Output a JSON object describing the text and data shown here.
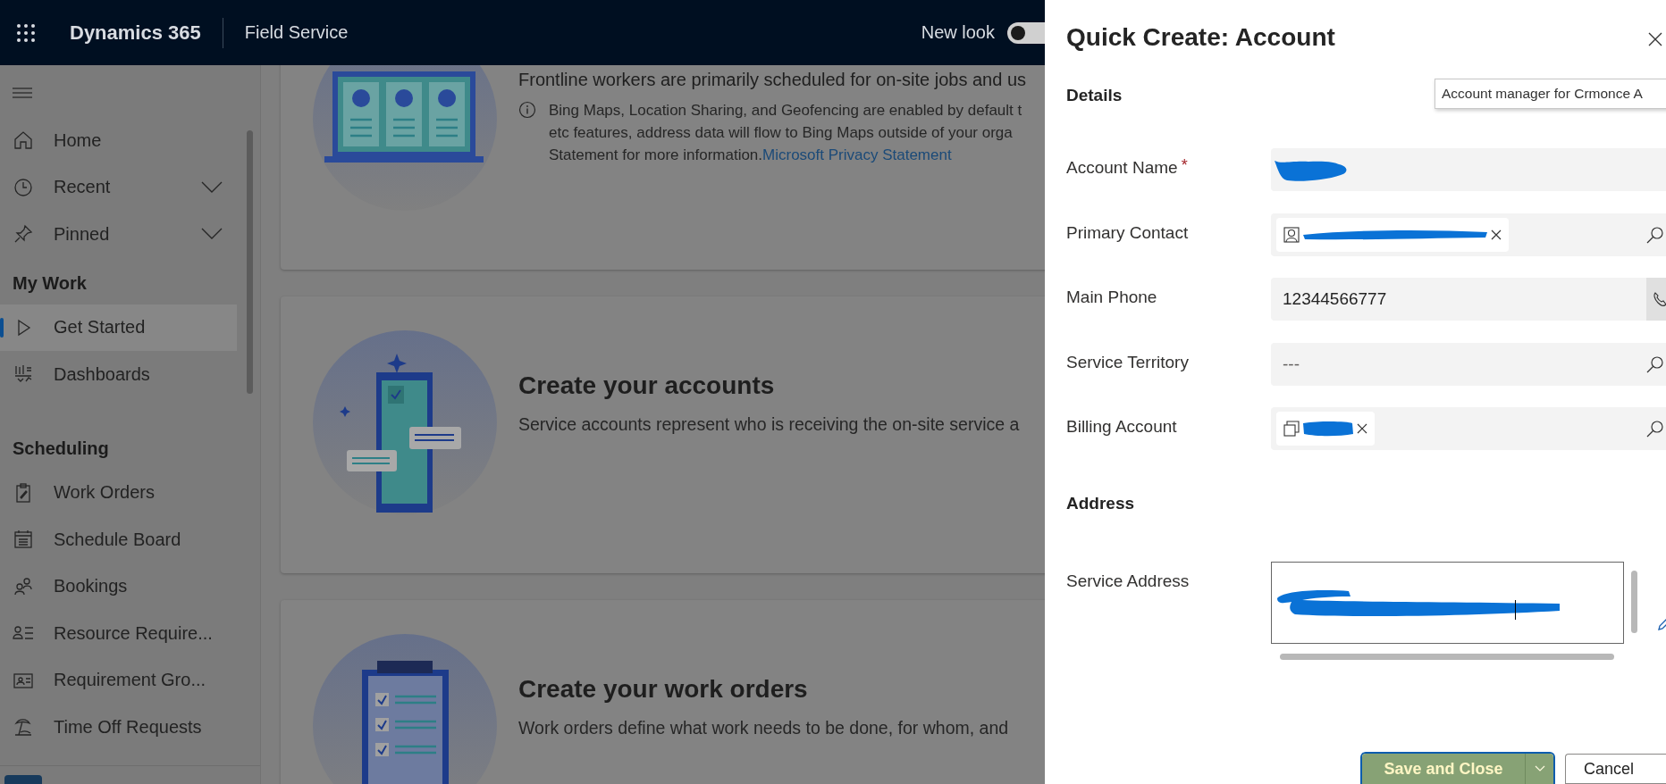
{
  "header": {
    "app_name": "Dynamics 365",
    "area": "Field Service",
    "new_look": {
      "label": "New look",
      "on": false
    }
  },
  "sidebar": {
    "groups": [
      {
        "items": [
          {
            "label": "Home",
            "selected": false
          },
          {
            "label": "Recent",
            "selected": false,
            "expanded": false
          },
          {
            "label": "Pinned",
            "selected": false,
            "expanded": false
          }
        ]
      },
      {
        "title": "My Work",
        "items": [
          {
            "label": "Get Started",
            "selected": true
          },
          {
            "label": "Dashboards",
            "selected": false
          }
        ]
      },
      {
        "title": "Scheduling",
        "items": [
          {
            "label": "Work Orders",
            "selected": false
          },
          {
            "label": "Schedule Board",
            "selected": false
          },
          {
            "label": "Bookings",
            "selected": false
          },
          {
            "label": "Resource Require...",
            "selected": false
          },
          {
            "label": "Requirement Gro...",
            "selected": false
          },
          {
            "label": "Time Off Requests",
            "selected": false
          }
        ]
      }
    ]
  },
  "cards": [
    {
      "kind": "laptop",
      "lead": "Frontline workers are primarily scheduled for on-site jobs and us",
      "note_lines": [
        "Bing Maps, Location Sharing, and Geofencing are enabled by default t",
        "etc features, address data will flow to Bing Maps outside of your orga",
        "Statement for more information."
      ],
      "link": "Microsoft Privacy Statement"
    },
    {
      "kind": "phone",
      "title": "Create your accounts",
      "text": "Service accounts represent who is receiving the on-site service a"
    },
    {
      "kind": "clipboard",
      "title": "Create your work orders",
      "text": "Work orders define what work needs to be done, for whom, and"
    }
  ],
  "quick_create": {
    "title": "Quick Create: Account",
    "tooltip": "Account manager for Crmonce A",
    "sections": [
      {
        "title": "Details",
        "fields": [
          {
            "label": "Account Name",
            "required_mark": "*",
            "kind": "text",
            "redacted": true
          },
          {
            "label": "Primary Contact",
            "kind": "lookup",
            "chip": {
              "kind": "contact",
              "redacted": true
            }
          },
          {
            "label": "Main Phone",
            "kind": "phone",
            "value": "12344566777"
          },
          {
            "label": "Service Territory",
            "kind": "lookup",
            "placeholder": "---"
          },
          {
            "label": "Billing Account",
            "kind": "lookup",
            "chip": {
              "kind": "account",
              "redacted": true
            }
          }
        ]
      },
      {
        "title": "Address",
        "fields": [
          {
            "label": "Service Address",
            "kind": "textarea",
            "redacted": true
          }
        ]
      }
    ],
    "buttons": [
      {
        "label": "Save and Close",
        "kind": "primary"
      },
      {
        "label": "Cancel",
        "kind": "secondary"
      }
    ]
  }
}
